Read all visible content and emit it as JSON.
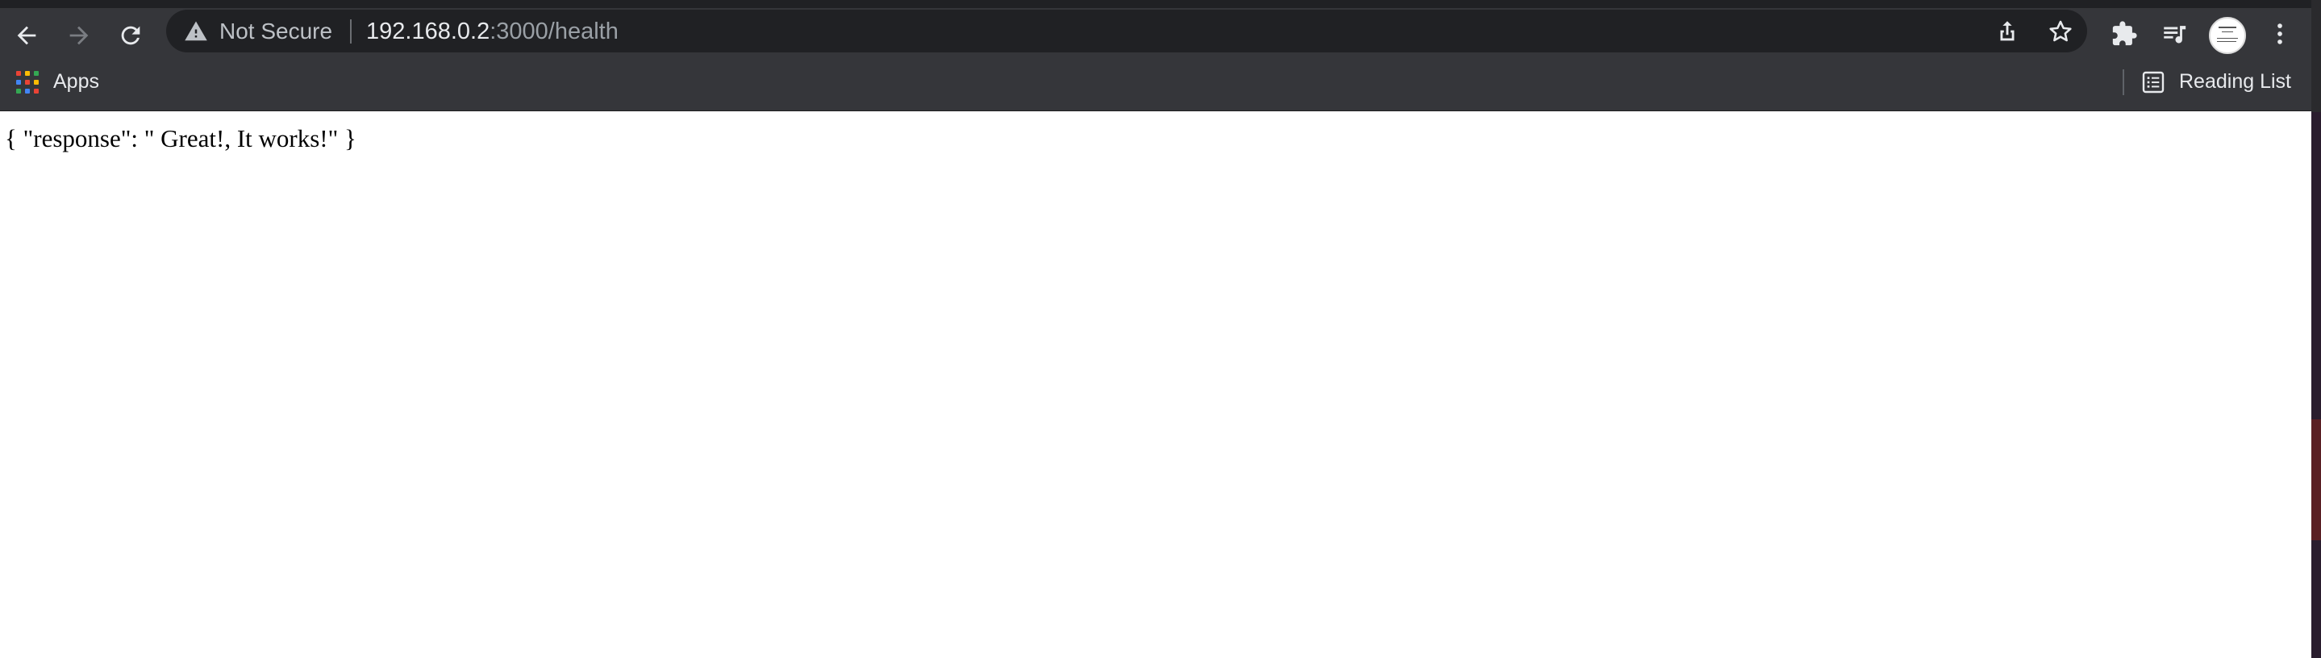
{
  "address_bar": {
    "security_label": "Not Secure",
    "url_host": "192.168.0.2",
    "url_path": ":3000/health"
  },
  "bookmarks_bar": {
    "apps_label": "Apps",
    "reading_list_label": "Reading List"
  },
  "page": {
    "body_text": "{ \"response\": \" Great!, It works!\" }"
  },
  "icons": {
    "back": "arrow-left-icon",
    "forward": "arrow-right-icon",
    "reload": "reload-icon",
    "warning": "warning-triangle-icon",
    "share": "share-icon",
    "bookmark": "star-icon",
    "extensions": "puzzle-icon",
    "media": "media-queue-icon",
    "menu": "kebab-menu-icon",
    "apps": "apps-grid-icon",
    "reading_list": "reading-list-icon"
  },
  "colors": {
    "toolbar_bg": "#35363a",
    "omnibox_bg": "#202124",
    "text_primary": "#e8eaed",
    "text_secondary": "#9aa0a6"
  }
}
